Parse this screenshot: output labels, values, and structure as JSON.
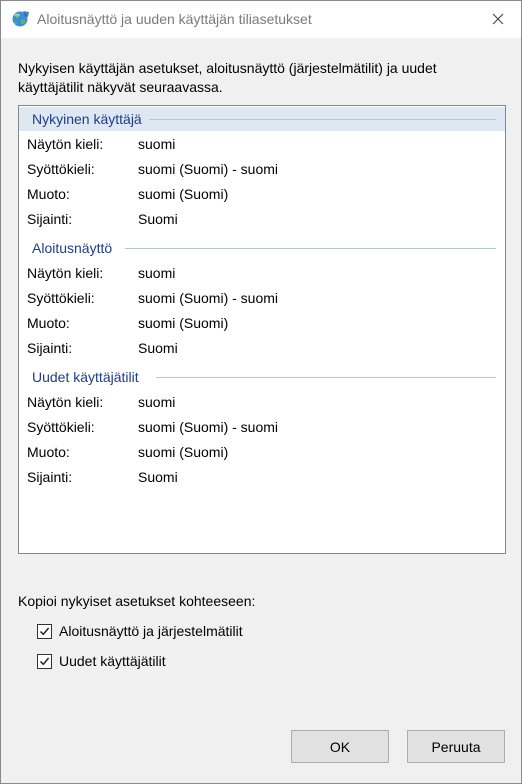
{
  "window": {
    "title": "Aloitusnäyttö ja uuden käyttäjän tiliasetukset",
    "icon": "globe-icon",
    "close_icon": "close-icon"
  },
  "intro_text": "Nykyisen käyttäjän asetukset, aloitusnäyttö (järjestelmätilit) ja uudet käyttäjätilit näkyvät seuraavassa.",
  "groups": [
    {
      "title": "Nykyinen käyttäjä",
      "rows": [
        {
          "label": "Näytön kieli:",
          "value": "suomi"
        },
        {
          "label": "Syöttökieli:",
          "value": "suomi (Suomi) - suomi"
        },
        {
          "label": "Muoto:",
          "value": "suomi (Suomi)"
        },
        {
          "label": "Sijainti:",
          "value": "Suomi"
        }
      ]
    },
    {
      "title": "Aloitusnäyttö",
      "rows": [
        {
          "label": "Näytön kieli:",
          "value": "suomi"
        },
        {
          "label": "Syöttökieli:",
          "value": "suomi (Suomi) - suomi"
        },
        {
          "label": "Muoto:",
          "value": "suomi (Suomi)"
        },
        {
          "label": "Sijainti:",
          "value": "Suomi"
        }
      ]
    },
    {
      "title": "Uudet käyttäjätilit",
      "rows": [
        {
          "label": "Näytön kieli:",
          "value": "suomi"
        },
        {
          "label": "Syöttökieli:",
          "value": "suomi (Suomi) - suomi"
        },
        {
          "label": "Muoto:",
          "value": "suomi (Suomi)"
        },
        {
          "label": "Sijainti:",
          "value": "Suomi"
        }
      ]
    }
  ],
  "copy_section": {
    "label": "Kopioi nykyiset asetukset kohteeseen:",
    "checkboxes": [
      {
        "label": "Aloitusnäyttö ja järjestelmätilit",
        "checked": true
      },
      {
        "label": "Uudet käyttäjätilit",
        "checked": true
      }
    ]
  },
  "buttons": {
    "ok": "OK",
    "cancel": "Peruuta"
  },
  "colors": {
    "group_title": "#1e3c8a",
    "selected_header": "#dde8f3",
    "button_face": "#e1e1e1"
  }
}
